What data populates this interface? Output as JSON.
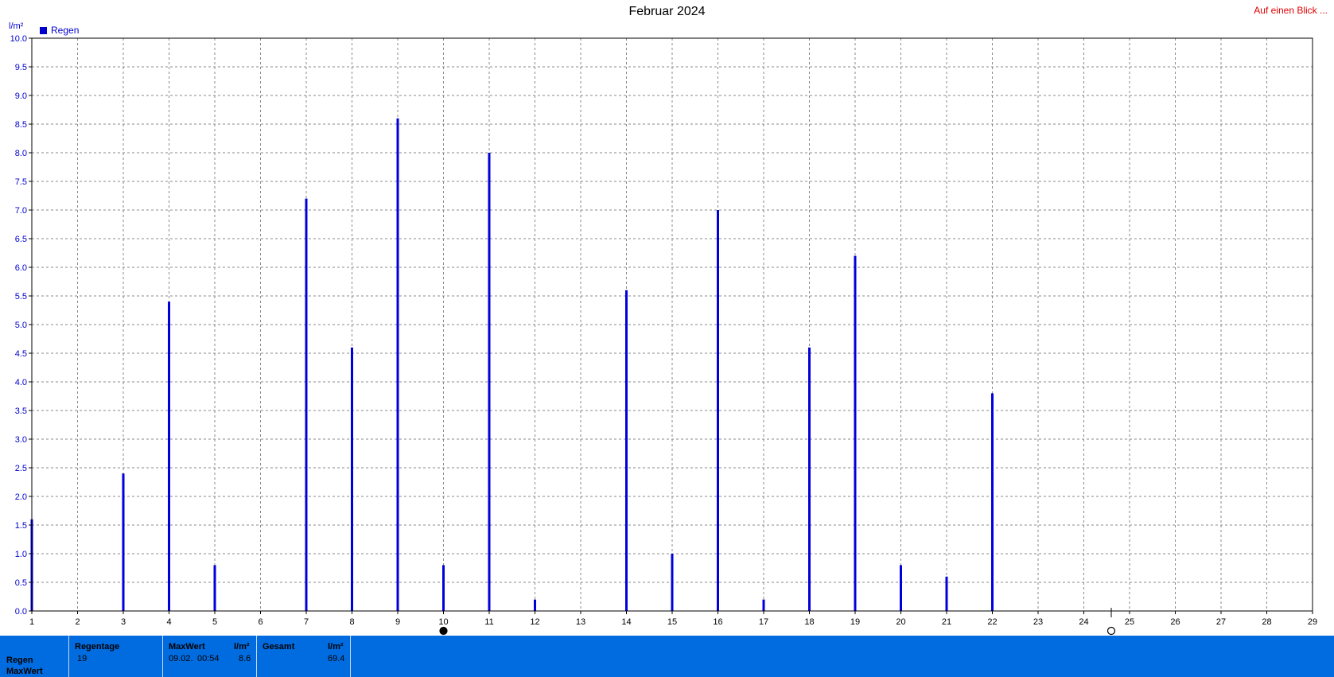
{
  "header": {
    "title": "Februar 2024",
    "link": "Auf einen Blick ...",
    "y_unit": "l/m²"
  },
  "chart_data": {
    "type": "bar",
    "title": "Februar 2024",
    "ylabel": "l/m²",
    "xlabel": "",
    "grid": true,
    "legend_position": "top-left",
    "ylim": [
      0,
      10
    ],
    "xlim": [
      1,
      29
    ],
    "x_ticks": [
      1,
      2,
      3,
      4,
      5,
      6,
      7,
      8,
      9,
      10,
      11,
      12,
      13,
      14,
      15,
      16,
      17,
      18,
      19,
      20,
      21,
      22,
      23,
      24,
      25,
      26,
      27,
      28,
      29
    ],
    "y_ticks": [
      0.0,
      0.5,
      1.0,
      1.5,
      2.0,
      2.5,
      3.0,
      3.5,
      4.0,
      4.5,
      5.0,
      5.5,
      6.0,
      6.5,
      7.0,
      7.5,
      8.0,
      8.5,
      9.0,
      9.5,
      10.0
    ],
    "series": [
      {
        "name": "Regen",
        "color": "#0000dd",
        "x": [
          1,
          3,
          4,
          5,
          7,
          8,
          9,
          10,
          11,
          12,
          14,
          15,
          16,
          17,
          18,
          19,
          20,
          21,
          22
        ],
        "values": [
          1.6,
          2.4,
          5.4,
          0.8,
          7.2,
          4.6,
          8.6,
          0.8,
          8.0,
          0.2,
          5.6,
          1.0,
          7.0,
          0.2,
          4.6,
          6.2,
          0.8,
          0.6,
          3.8
        ]
      }
    ],
    "markers": [
      {
        "x": 10,
        "symbol": "full-moon-icon"
      },
      {
        "x": 24.6,
        "symbol": "new-moon-icon"
      }
    ]
  },
  "summary": {
    "row_labels": [
      "Regen",
      "MaxWert"
    ],
    "regentage_label": "Regentage",
    "regentage_value": "19",
    "maxwert_label": "MaxWert",
    "maxwert_unit": "l/m²",
    "maxwert_date": "09.02.",
    "maxwert_time": "00:54",
    "maxwert_value": "8.6",
    "gesamt_label": "Gesamt",
    "gesamt_unit": "l/m²",
    "gesamt_value": "69.4"
  }
}
